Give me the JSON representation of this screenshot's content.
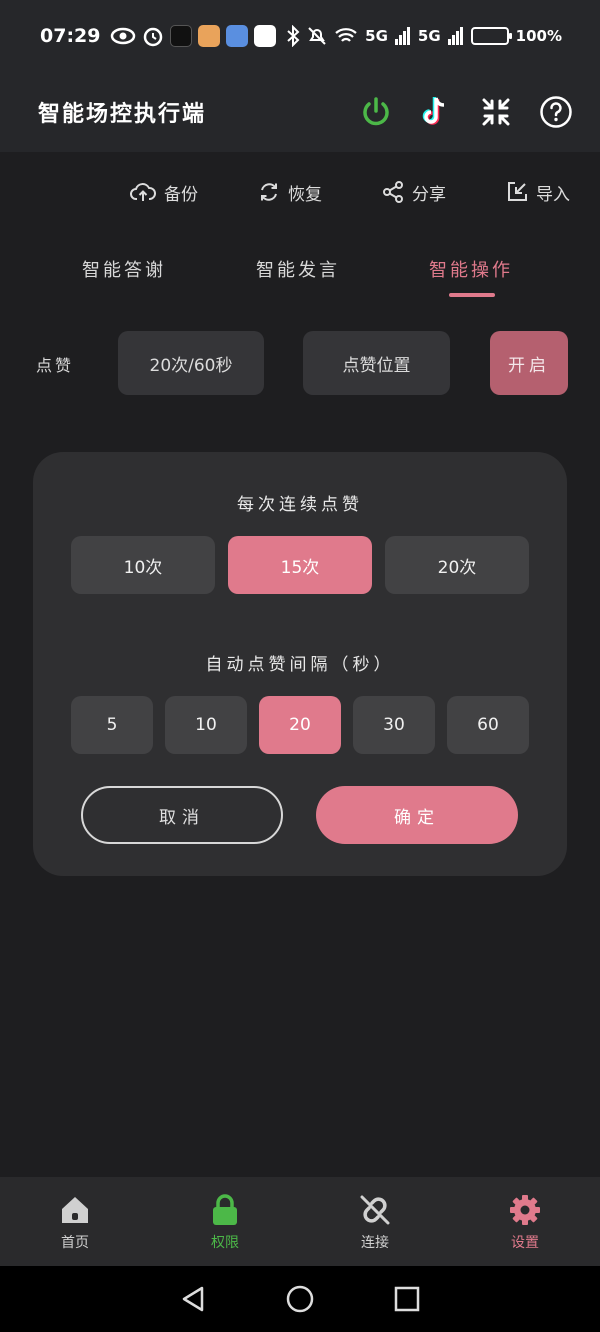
{
  "status": {
    "time": "07:29",
    "battery": "100%",
    "network1": "5G",
    "network2": "5G"
  },
  "header": {
    "title": "智能场控执行端"
  },
  "toolbar": [
    {
      "label": "备份",
      "icon": "cloud-upload-icon"
    },
    {
      "label": "恢复",
      "icon": "refresh-icon"
    },
    {
      "label": "分享",
      "icon": "share-icon"
    },
    {
      "label": "导入",
      "icon": "import-icon"
    }
  ],
  "tabs": [
    {
      "label": "智能答谢"
    },
    {
      "label": "智能发言"
    },
    {
      "label": "智能操作"
    }
  ],
  "like": {
    "label": "点赞",
    "rate": "20次/60秒",
    "position": "点赞位置",
    "start": "开启"
  },
  "dialog": {
    "count_title": "每次连续点赞",
    "count_options": [
      "10次",
      "15次",
      "20次"
    ],
    "interval_title": "自动点赞间隔（秒）",
    "interval_options": [
      "5",
      "10",
      "20",
      "30",
      "60"
    ],
    "cancel": "取消",
    "confirm": "确定"
  },
  "nav": [
    {
      "label": "首页",
      "icon": "home-icon",
      "color": "#d0d0d0"
    },
    {
      "label": "权限",
      "icon": "lock-icon",
      "color": "#4cb848"
    },
    {
      "label": "连接",
      "icon": "link-broken-icon",
      "color": "#d0d0d0"
    },
    {
      "label": "设置",
      "icon": "gear-icon",
      "color": "#e07a8c"
    }
  ],
  "colors": {
    "accent": "#e07a8c",
    "power": "#4cb848",
    "background": "#1e1e20"
  }
}
